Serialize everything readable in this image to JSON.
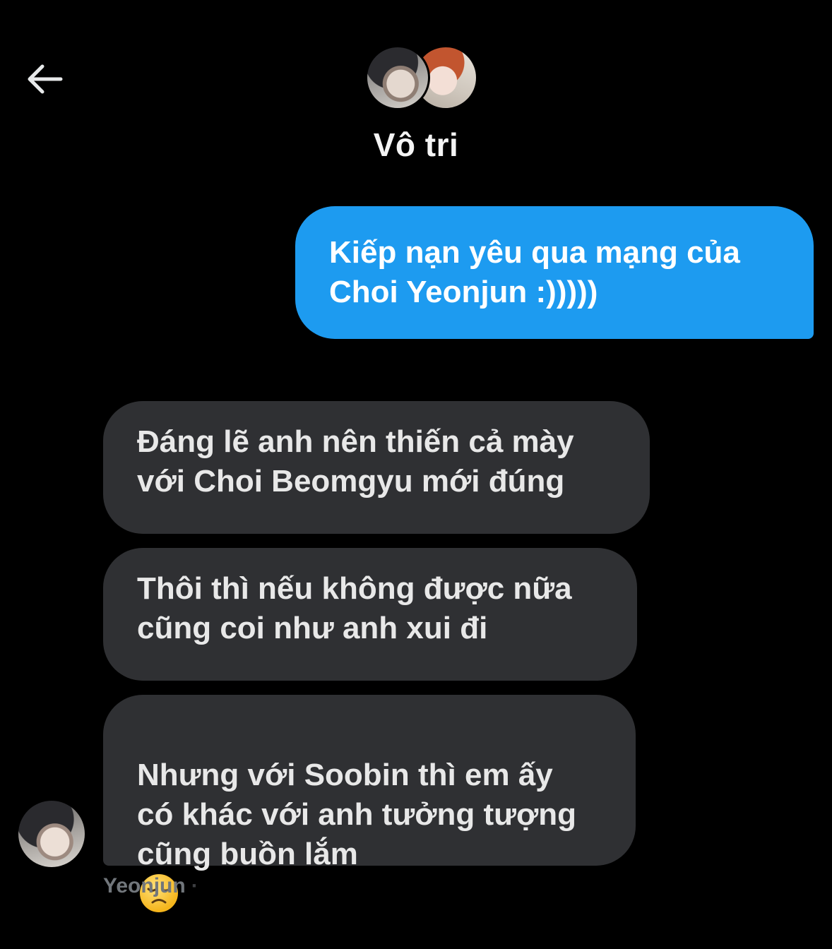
{
  "header": {
    "back_icon": "arrow-left-icon",
    "title": "Vô tri"
  },
  "messages": [
    {
      "direction": "sent",
      "text": "Kiếp nạn yêu qua mạng của\nChoi Yeonjun :)))))"
    },
    {
      "direction": "received",
      "text": "Đáng lẽ anh nên thiến cả mày\nvới Choi Beomgyu mới đúng"
    },
    {
      "direction": "received",
      "text": "Thôi thì nếu không được nữa\ncũng coi như anh xui đi"
    },
    {
      "direction": "received",
      "text": "Nhưng với Soobin thì em ấy\ncó khác với anh tưởng tượng\ncũng buồn lắm",
      "emoji": "disappointed-face-icon"
    }
  ],
  "sender": {
    "name": "Yeonjun",
    "separator": "·"
  },
  "colors": {
    "background": "#000000",
    "sent_bubble": "#1d9bf0",
    "received_bubble": "#2f3033",
    "secondary_text": "#71767b"
  }
}
